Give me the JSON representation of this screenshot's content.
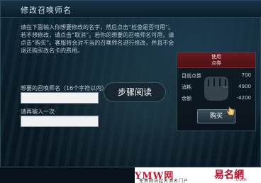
{
  "dialog": {
    "title": "修改召唤师名",
    "description": "请在下面输入你想要修改的名字，然后点击“检查是否可用”。若不想修改，请点击“取消”。若你的想要的召唤师名可用，请点击“购买”。客服将会对不当的召唤师名进行修改，并且不会退还购买改名卡的费用。"
  },
  "form": {
    "name_label": "想要的召唤师名（16个字符以内）",
    "name_value": "",
    "confirm_label": "请再输入一次",
    "confirm_value": ""
  },
  "step_button": {
    "label": "步骤阅读"
  },
  "purchase_panel": {
    "header_line1": "使用",
    "header_line2": "点券",
    "rows": [
      {
        "label": "目前点券",
        "sign": "",
        "value": "700"
      },
      {
        "label": "消耗",
        "sign": "—",
        "value": "4900"
      },
      {
        "label": "余额",
        "sign": "",
        "value": "-4200"
      }
    ],
    "buy_label": "购买",
    "fist_icon": "fist-icon",
    "cursor_icon": "hand-cursor-icon"
  },
  "watermark": {
    "logo": "YMW网",
    "brand": "易名網",
    "brand_suffix": ".com",
    "subtitle": "免费网站起名测名门户"
  },
  "colors": {
    "panel_header": "#6a1b1f",
    "accent_red": "#c0142b",
    "dialog_bg": "#0e2433"
  }
}
